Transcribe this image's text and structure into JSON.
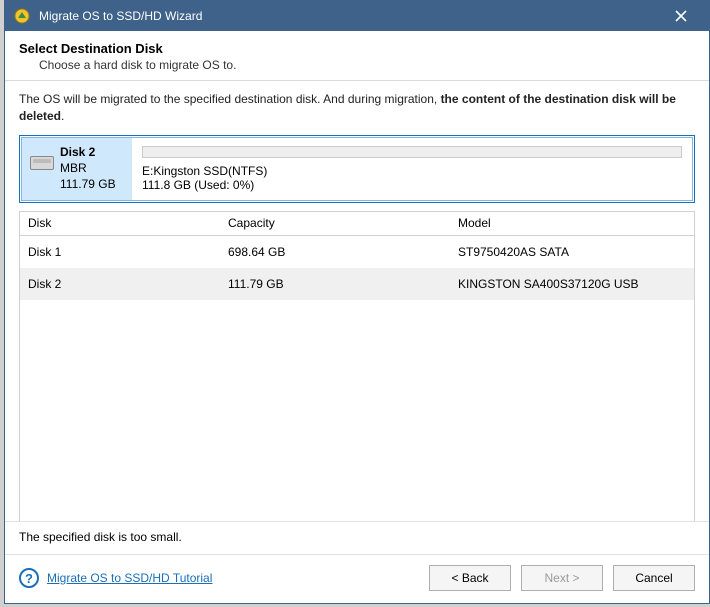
{
  "titlebar": {
    "title": "Migrate OS to SSD/HD Wizard"
  },
  "header": {
    "title": "Select Destination Disk",
    "subtitle": "Choose a hard disk to migrate OS to."
  },
  "warning": {
    "prefix": "The OS will be migrated to the specified destination disk. And during migration, ",
    "bold": "the content of the destination disk will be deleted",
    "suffix": "."
  },
  "selected_disk": {
    "name": "Disk 2",
    "scheme": "MBR",
    "size": "111.79 GB",
    "partition_label": "E:Kingston SSD(NTFS)",
    "partition_usage": "111.8 GB (Used: 0%)"
  },
  "table": {
    "headers": {
      "disk": "Disk",
      "capacity": "Capacity",
      "model": "Model"
    },
    "rows": [
      {
        "disk": "Disk 1",
        "capacity": "698.64 GB",
        "model": "ST9750420AS SATA"
      },
      {
        "disk": "Disk 2",
        "capacity": "111.79 GB",
        "model": "KINGSTON SA400S37120G USB"
      }
    ]
  },
  "status": "The specified disk is too small.",
  "footer": {
    "tutorial_label": "Migrate OS to SSD/HD Tutorial",
    "back": "< Back",
    "next": "Next >",
    "cancel": "Cancel"
  }
}
